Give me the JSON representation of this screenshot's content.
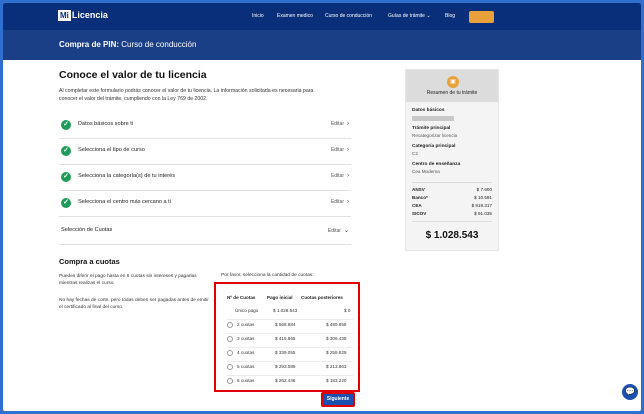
{
  "nav": {
    "logo_mi": "Mi",
    "logo_text": "Licencia",
    "logo_sub": "by Licenciaflow",
    "links": [
      "Inicio",
      "Examen medico",
      "Curso de conducción",
      "Guías de trámite",
      "Blog"
    ],
    "guide_chevron": "chevron-down-icon",
    "cta_color": "#e9a23b"
  },
  "banner": {
    "title_bold": "Compra de PIN:",
    "title_rest": " Curso de conducción"
  },
  "main": {
    "heading": "Conoce el valor de tu licencia",
    "intro": "Al completar este formulario podrás conocer el valor de tu licencia. La información solicitada es necesaria para conocer el valor del trámite, cumpliendo con la Ley 769 de 2002.",
    "steps": [
      {
        "label": "Datos básicos sobre ti",
        "edit": "Editar"
      },
      {
        "label": "Selecciona el tipo de curso",
        "edit": "Editar"
      },
      {
        "label": "Selecciona la categoría(s) de tu interés",
        "edit": "Editar"
      },
      {
        "label": "Selecciona el centro más cercano a ti",
        "edit": "Editar"
      }
    ],
    "cuotas_step": {
      "label": "Selección de Cuotas",
      "edit": "Editar"
    }
  },
  "cuotas": {
    "title": "Compra a cuotas",
    "note1": "Puedes diferir el pago hasta en 6 cuotas sin intereses y pagarlas mientras realizas el curso.",
    "note2": "No hay fechas de corte, pero todas deben ser pagadas antes de emitir el certificado al final del curso.",
    "hint": "Por favor, selecciona la cantidad de cuotas:",
    "headers": [
      "Nº de Cuotas",
      "Pago inicial",
      "Cuotas posteriores"
    ],
    "rows": [
      [
        "Único pago",
        "$ 1.028.543",
        "$ 0"
      ],
      [
        "2 cuotas",
        "$ 568.884",
        "$ 489.658"
      ],
      [
        "3 cuotas",
        "$ 415.665",
        "$ 306.439"
      ],
      [
        "4 cuotas",
        "$ 339.055",
        "$ 259.829"
      ],
      [
        "5 cuotas",
        "$ 293.089",
        "$ 213.863"
      ],
      [
        "6 cuotas",
        "$ 262.446",
        "$ 183.220"
      ]
    ],
    "button": "Siguiente"
  },
  "summary": {
    "title": "Resumen de tu trámite",
    "items": [
      {
        "label": "Datos básicos"
      },
      {
        "label": "Trámite principal",
        "value": "Recategorizar licencia"
      },
      {
        "label": "Categoría principal",
        "value": "C2"
      },
      {
        "label": "Centro de enseñanza",
        "value": "Cea Moderna"
      }
    ],
    "fees": [
      {
        "name": "ANSV",
        "value": "$ 7.600"
      },
      {
        "name": "Banco*",
        "value": "$ 10.591"
      },
      {
        "name": "CEA",
        "value": "$ 919.317"
      },
      {
        "name": "SICOV",
        "value": "$ 91.035"
      }
    ],
    "total": "$ 1.028.543"
  }
}
